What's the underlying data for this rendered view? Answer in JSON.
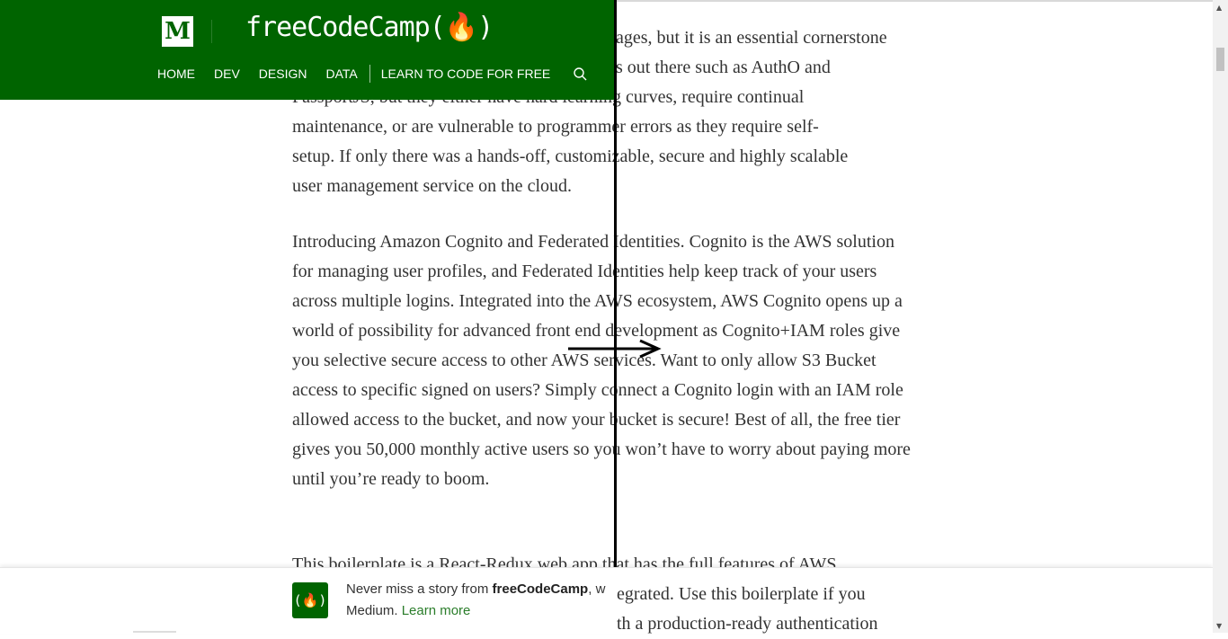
{
  "header": {
    "logo_letter": "M",
    "publication": "freeCodeCamp(🔥)",
    "nav": [
      "HOME",
      "DEV",
      "DESIGN",
      "DATA",
      "LEARN TO CODE FOR FREE"
    ],
    "search_icon": "search-icon",
    "background": "#006400"
  },
  "article": {
    "paragraphs": [
      "ges, but it is an essential cornerstone s out there such as AuthO and PassportJS, but they either have hard learning curves, require continual maintenance, or are vulnerable to programmer errors as they require self-setup. If only there was a hands-off, customizable, secure and highly scalable user management service on the cloud.",
      "Introducing Amazon Cognito and Federated Identities. Cognito is the AWS solution for managing user profiles, and Federated Identities help keep track of your users across multiple logins. Integrated into the AWS ecosystem, AWS Cognito opens up a world of possibility for advanced front end development as Cognito+IAM roles give you selective secure access to other AWS services. Want to only allow S3 Bucket access to specific signed on users? Simply connect a Cognito login with an IAM role allowed access to the bucket, and now your bucket is secure! Best of all, the free tier gives you 50,000 monthly active users so you won’t have to worry about paying more until you’re ready to boom.",
      "This boilerplate is a React-Redux web app that has the full features of AWS"
    ],
    "tail_lines": [
      "egrated. Use this boilerplate if you",
      "th a production-ready authentication"
    ]
  },
  "banner": {
    "icon_text": "(🔥)",
    "prefix": "Never miss a story from ",
    "publication": "freeCodeCamp",
    "suffix": ", w",
    "line2": "Medium. ",
    "link": "Learn more"
  }
}
